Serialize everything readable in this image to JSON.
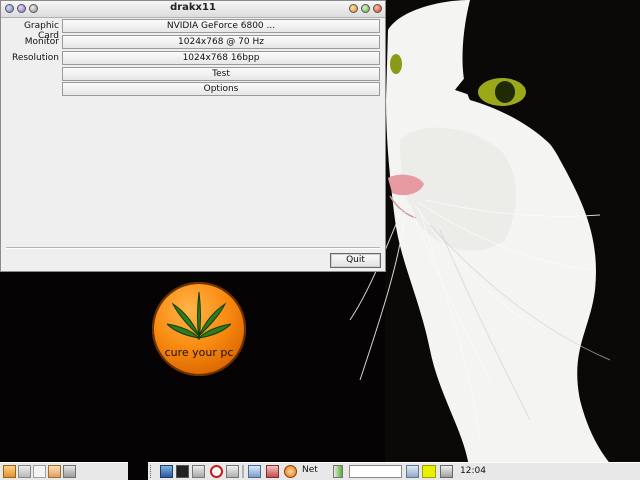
{
  "window": {
    "title": "drakx11",
    "rows": [
      {
        "label": "Graphic Card",
        "value": "NVIDIA GeForce 6800 ..."
      },
      {
        "label": "Monitor",
        "value": "1024x768 @ 70 Hz"
      },
      {
        "label": "Resolution",
        "value": "1024x768 16bpp"
      }
    ],
    "test_label": "Test",
    "options_label": "Options",
    "quit_label": "Quit"
  },
  "desktop": {
    "badge_text": "cure your pc"
  },
  "panel": {
    "net_label": "Net",
    "search_value": "",
    "clock": "12:04"
  },
  "icons": {
    "titlebar_left": [
      "window-menu-icon",
      "sticky-icon",
      "shade-icon"
    ],
    "titlebar_right": [
      "minimize-icon",
      "maximize-icon",
      "close-icon"
    ],
    "panel_left": [
      "menu-icon",
      "pencil-icon",
      "blank-icon",
      "documents-icon",
      "trash-icon"
    ],
    "panel_right": [
      "drag-handle-icon",
      "show-desktop-icon",
      "terminal-icon",
      "mixer-icon",
      "opera-icon",
      "tools-icon",
      "sep",
      "mixer-slider-icon",
      "computer-icon",
      "browser-icon",
      "network-icon",
      "volume-icon"
    ]
  },
  "colors": {
    "badge_orange": "#f88a10",
    "leaf_green": "#2e7d1a"
  }
}
